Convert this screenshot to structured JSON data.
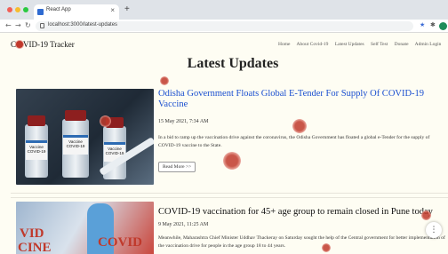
{
  "browser": {
    "tab_title": "React App",
    "tab_close": "×",
    "new_tab": "+",
    "url": "localhost:3000/latest-updates"
  },
  "header": {
    "brand_prefix": "C",
    "brand_suffix": "VID-19 Tracker",
    "nav": [
      "Home",
      "About Covid-19",
      "Latest Updates",
      "Self Test",
      "Donate",
      "Admin Login"
    ]
  },
  "page": {
    "title": "Latest Updates"
  },
  "articles": [
    {
      "headline": "Odisha Government Floats Global E-Tender For Supply Of COVID-19 Vaccine",
      "date": "15 May 2021, 7:34 AM",
      "excerpt": "In a bid to ramp up the vaccination drive against the coronavirus, the Odisha Government has floated a global e-Tender for the supply of COVID-19 vaccine to the State.",
      "read_more": "Read More >>",
      "image": {
        "vial_labels": [
          "Vaccine COVID-19",
          "Vaccine COVID-19",
          "Vaccine COVID-19"
        ]
      }
    },
    {
      "headline": "COVID-19 vaccination for 45+ age group to remain closed in Pune today",
      "date": "9 May 2021, 11:25 AM",
      "excerpt": "Meanwhile, Maharashtra Chief Minister Uddhav Thackeray on Saturday sought the help of the Central government for better implementation of the vaccination drive for people in the age group 18 to 44 years.",
      "image": {
        "words": [
          "VID",
          "COVID",
          "CINE"
        ]
      }
    }
  ],
  "fab": {
    "icon": "more-vertical-icon"
  },
  "colors": {
    "headline_link": "#1a4fd0",
    "virus": "#c0392b",
    "background": "#fefdf3"
  }
}
